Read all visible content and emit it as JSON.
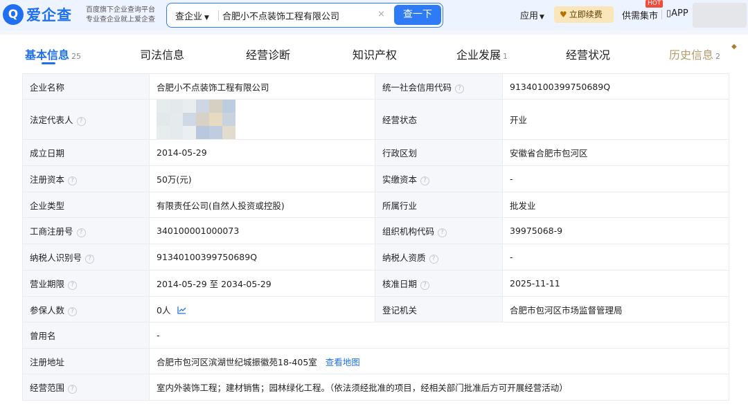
{
  "header": {
    "logo_mark": "Q",
    "logo_text": "爱企查",
    "slogan_line1": "百度旗下企业查询平台",
    "slogan_line2": "专业查企业就上爱企查",
    "search_type": "查企业",
    "search_value": "合肥小不点装饰工程有限公司",
    "search_button": "查一下",
    "nav_app": "应用",
    "renew_button": "立即续费",
    "supply_market": "供需集市",
    "hot_badge": "HOT",
    "app_link": "APP"
  },
  "tabs": [
    {
      "label": "基本信息",
      "count": "25"
    },
    {
      "label": "司法信息",
      "count": ""
    },
    {
      "label": "经营诊断",
      "count": ""
    },
    {
      "label": "知识产权",
      "count": ""
    },
    {
      "label": "企业发展",
      "count": "1"
    },
    {
      "label": "经营状况",
      "count": ""
    },
    {
      "label": "历史信息",
      "count": "2"
    }
  ],
  "info": {
    "company_name_label": "企业名称",
    "company_name": "合肥小不点装饰工程有限公司",
    "credit_code_label": "统一社会信用代码",
    "credit_code": "91340100399750689Q",
    "legal_rep_label": "法定代表人",
    "status_label": "经营状态",
    "status": "开业",
    "founded_label": "成立日期",
    "founded": "2014-05-29",
    "region_label": "行政区划",
    "region": "安徽省合肥市包河区",
    "reg_capital_label": "注册资本",
    "reg_capital": "50万(元)",
    "paid_capital_label": "实缴资本",
    "paid_capital": "-",
    "type_label": "企业类型",
    "type": "有限责任公司(自然人投资或控股)",
    "industry_label": "所属行业",
    "industry": "批发业",
    "reg_no_label": "工商注册号",
    "reg_no": "340100001000073",
    "org_code_label": "组织机构代码",
    "org_code": "39975068-9",
    "taxpayer_id_label": "纳税人识别号",
    "taxpayer_id": "91340100399750689Q",
    "taxpayer_qual_label": "纳税人资质",
    "taxpayer_qual": "-",
    "term_label": "营业期限",
    "term": "2014-05-29 至 2034-05-29",
    "approved_label": "核准日期",
    "approved": "2025-11-11",
    "insured_label": "参保人数",
    "insured": "0人",
    "authority_label": "登记机关",
    "authority": "合肥市包河区市场监督管理局",
    "former_name_label": "曾用名",
    "former_name": "-",
    "address_label": "注册地址",
    "address": "合肥市包河区滨湖世纪城振徽苑18-405室",
    "map_link": "查看地图",
    "scope_label": "经营范围",
    "scope": "室内外装饰工程；建材销售；园林绿化工程。（依法须经批准的项目，经相关部门批准后方可开展经营活动）"
  },
  "help_glyph": "?",
  "colors": {
    "accent": "#1f6ff0",
    "label_bg": "#f5f7fa",
    "border": "#e8ebf0",
    "renew_bg": "#fbe6bb",
    "hot": "#f04b3d"
  },
  "icons": [
    "search-logo-icon",
    "caret-down-icon",
    "clear-icon",
    "heart-icon",
    "app-icon",
    "help-icon",
    "trend-chart-icon",
    "diamond-icon"
  ]
}
